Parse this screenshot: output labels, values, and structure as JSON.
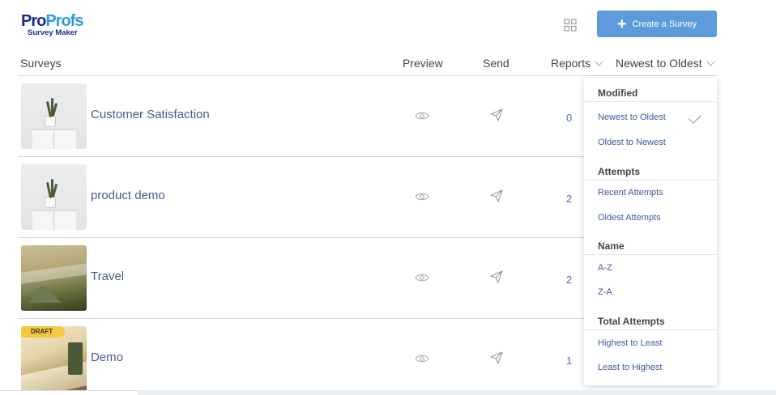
{
  "brand": {
    "logo_part1": "Pro",
    "logo_part2": "Profs",
    "logo_sub": "Survey Maker"
  },
  "toolbar": {
    "grid_icon": "grid-view-icon",
    "create_label": "Create a Survey"
  },
  "table": {
    "headers": {
      "surveys": "Surveys",
      "preview": "Preview",
      "send": "Send",
      "reports": "Reports",
      "sort": "Newest to Oldest"
    },
    "rows": [
      {
        "title": "Customer Satisfaction",
        "count": "0",
        "draft": ""
      },
      {
        "title": "product demo",
        "count": "2",
        "draft": ""
      },
      {
        "title": "Travel",
        "count": "2",
        "draft": ""
      },
      {
        "title": "Demo",
        "count": "1",
        "draft": "DRAFT"
      }
    ]
  },
  "sort_menu": {
    "groups": [
      {
        "label": "Modified",
        "items": [
          "Newest to Oldest",
          "Oldest to Newest"
        ]
      },
      {
        "label": "Attempts",
        "items": [
          "Recent Attempts",
          "Oldest Attempts"
        ]
      },
      {
        "label": "Name",
        "items": [
          "A-Z",
          "Z-A"
        ]
      },
      {
        "label": "Total Attempts",
        "items": [
          "Highest to Least",
          "Least to Highest"
        ]
      }
    ],
    "selected": "Newest to Oldest"
  },
  "colors": {
    "accent": "#5e9bdb",
    "link": "#4a5c8c",
    "draft": "#f5c842",
    "check": "#6da36d"
  }
}
